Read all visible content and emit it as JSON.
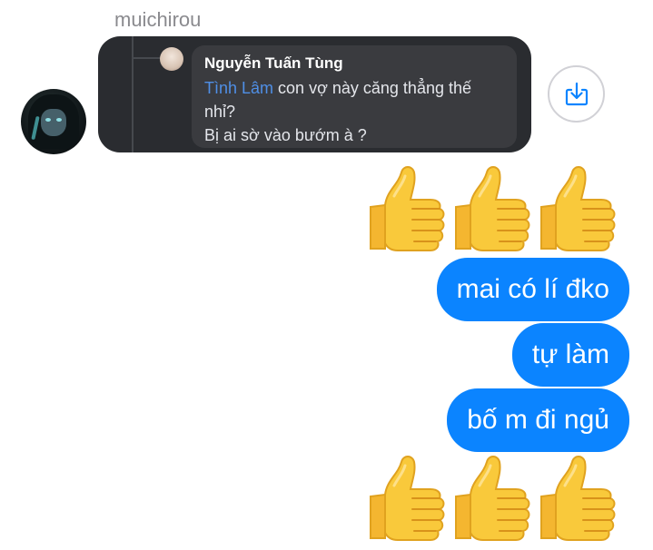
{
  "conversation": {
    "sender_name": "muichirou"
  },
  "shared_post": {
    "reply": {
      "author": "Nguyễn Tuấn Tùng",
      "mention": "Tình Lâm",
      "text_after_mention": " con vợ này căng thẳng thế nhỉ?",
      "text_line_2": "Bị ai sờ vào bướm à ?"
    }
  },
  "icons": {
    "share": "share-download-icon",
    "reaction": "thumbs-up-emoji"
  },
  "messages": [
    {
      "text": "mai có lí đko"
    },
    {
      "text": "tự làm"
    },
    {
      "text": "bố m đi ngủ"
    }
  ],
  "colors": {
    "bubble": "#0b84ff",
    "card": "#2a2c30",
    "mention": "#4f8fe6",
    "share_icon": "#0b84ff"
  }
}
